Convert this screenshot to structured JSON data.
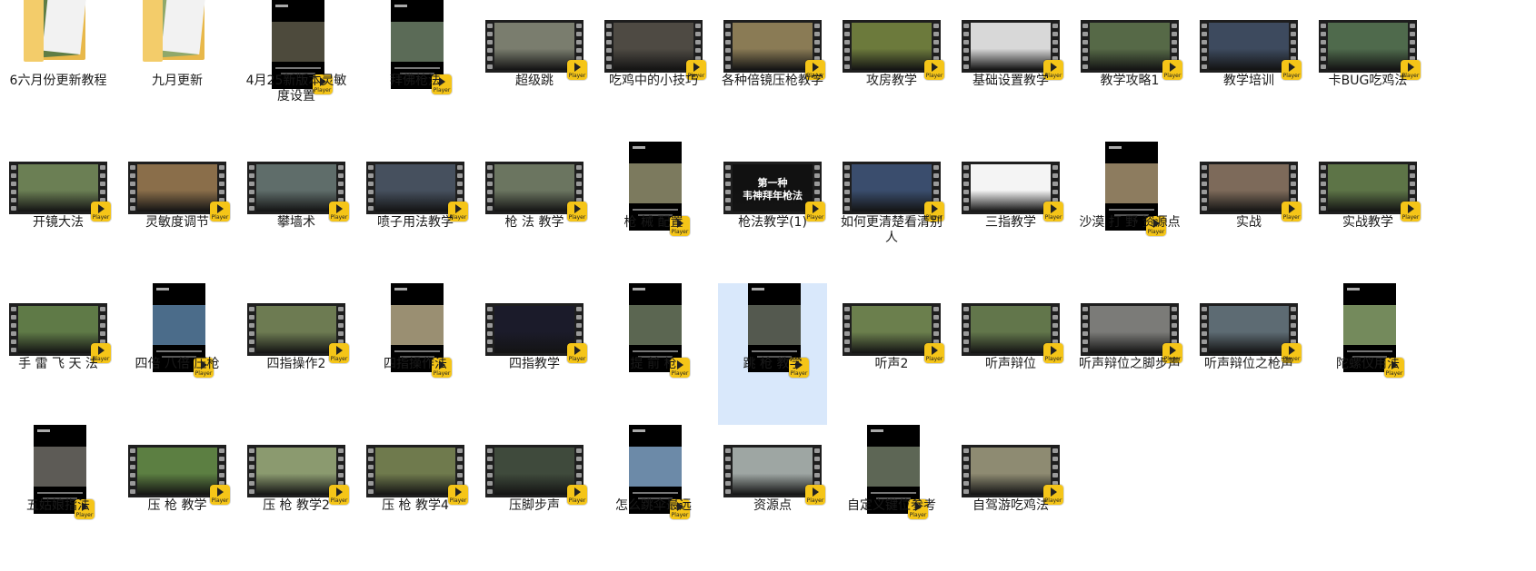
{
  "badge_label": "Player",
  "items": [
    {
      "label": "6六月份更新教程",
      "kind": "folder",
      "color": "#5e7d45"
    },
    {
      "label": "九月更新",
      "kind": "folder",
      "color": "#8fa86a"
    },
    {
      "label": "4月25新版本灵敏度设置",
      "kind": "phone",
      "color": "#4d4a3c"
    },
    {
      "label": "拜佛枪法",
      "kind": "phone",
      "color": "#5b6b57"
    },
    {
      "label": "超级跳",
      "kind": "film",
      "color": "#7a7d6e"
    },
    {
      "label": "吃鸡中的小技巧",
      "kind": "film",
      "color": "#4e4a43"
    },
    {
      "label": "各种倍镜压枪教学",
      "kind": "film",
      "color": "#8a7b55"
    },
    {
      "label": "攻房教学",
      "kind": "film",
      "color": "#6c7a3c"
    },
    {
      "label": "基础设置教学",
      "kind": "film",
      "color": "#d8d8d8"
    },
    {
      "label": "教学攻略1",
      "kind": "film",
      "color": "#566947"
    },
    {
      "label": "教学培训",
      "kind": "film",
      "color": "#3d4a5e"
    },
    {
      "label": "卡BUG吃鸡法",
      "kind": "film",
      "color": "#4f6a4c"
    },
    {
      "label": "开镜大法",
      "kind": "film",
      "color": "#6b7f54"
    },
    {
      "label": "灵敏度调节",
      "kind": "film",
      "color": "#8a6e4a"
    },
    {
      "label": "攀墙术",
      "kind": "film",
      "color": "#5f6d6a"
    },
    {
      "label": "喷子用法教学",
      "kind": "film",
      "color": "#46505e"
    },
    {
      "label": "枪 法 教学",
      "kind": "film",
      "color": "#6b7560"
    },
    {
      "label": "枪 械 配置",
      "kind": "phone",
      "color": "#7c7a5e"
    },
    {
      "label": "枪法教学(1)",
      "kind": "film",
      "color": "#111111",
      "overlay": "第一种\n韦神拜年枪法"
    },
    {
      "label": "如何更清楚看清别人",
      "kind": "film",
      "color": "#3a4d6d"
    },
    {
      "label": "三指教学",
      "kind": "film",
      "color": "#f4f4f4"
    },
    {
      "label": "沙漠 打 野 资源点",
      "kind": "phone",
      "color": "#8d7c5f"
    },
    {
      "label": "实战",
      "kind": "film",
      "color": "#7d6a5a"
    },
    {
      "label": "实战教学",
      "kind": "film",
      "color": "#5d7447"
    },
    {
      "label": "手 雷 飞 天 法",
      "kind": "film",
      "color": "#5f7a47"
    },
    {
      "label": "四倍 八倍 压枪",
      "kind": "phone",
      "color": "#4b6c8a"
    },
    {
      "label": "四指操作2",
      "kind": "film",
      "color": "#6d7b52"
    },
    {
      "label": "四指操作法",
      "kind": "phone",
      "color": "#9a8f72"
    },
    {
      "label": "四指教学",
      "kind": "film",
      "color": "#1b1b2a"
    },
    {
      "label": "提 前 枪",
      "kind": "phone",
      "color": "#5b6651"
    },
    {
      "label": "跳 枪 教学",
      "kind": "phone",
      "color": "#54594f",
      "selected": true
    },
    {
      "label": "听声2",
      "kind": "film",
      "color": "#6b7f4d"
    },
    {
      "label": "听声辩位",
      "kind": "film",
      "color": "#62764b"
    },
    {
      "label": "听声辩位之脚步声",
      "kind": "film",
      "color": "#7b7b78"
    },
    {
      "label": "听声辩位之枪声",
      "kind": "film",
      "color": "#5d6b73"
    },
    {
      "label": "陀螺仪用法",
      "kind": "phone",
      "color": "#748a5c"
    },
    {
      "label": "五姑娘指法",
      "kind": "phone",
      "color": "#5d5b56"
    },
    {
      "label": "压 枪 教学",
      "kind": "film",
      "color": "#5c7f42"
    },
    {
      "label": "压 枪 教学2",
      "kind": "film",
      "color": "#8b9a6f"
    },
    {
      "label": "压 枪 教学4",
      "kind": "film",
      "color": "#6f7a4d"
    },
    {
      "label": "压脚步声",
      "kind": "film",
      "color": "#3f4a3c"
    },
    {
      "label": "怎么跳伞最远",
      "kind": "phone",
      "color": "#6c8aa8"
    },
    {
      "label": "资源点",
      "kind": "film",
      "color": "#9ea6a3"
    },
    {
      "label": "自定义键位参考",
      "kind": "phone",
      "color": "#5d6655"
    },
    {
      "label": "自驾游吃鸡法",
      "kind": "film",
      "color": "#8e8b72"
    }
  ]
}
